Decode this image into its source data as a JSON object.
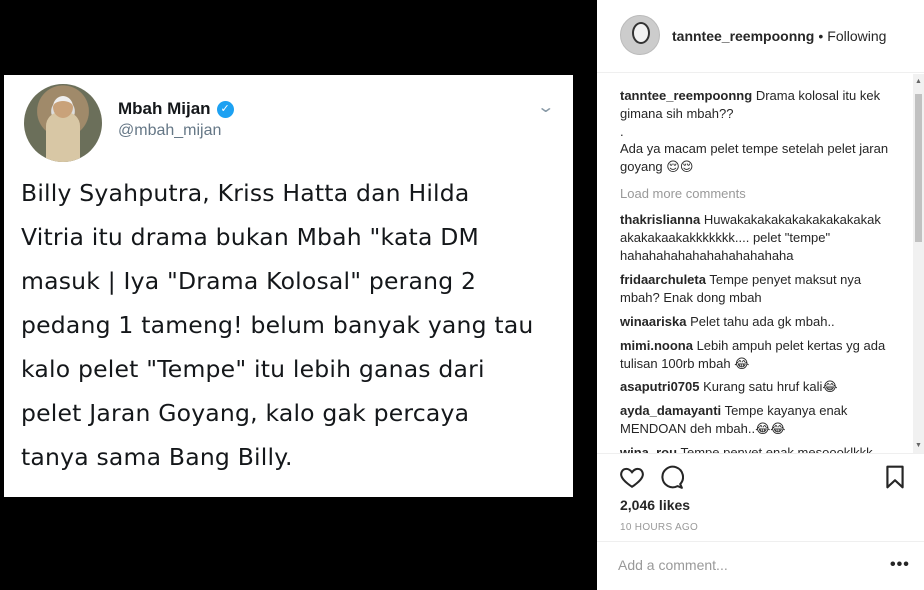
{
  "tweet": {
    "name": "Mbah Mijan",
    "handle": "@mbah_mijan",
    "text_lines": [
      "Billy Syahputra, Kriss Hatta dan Hilda",
      "Vitria itu drama bukan Mbah \"kata DM",
      "masuk | Iya \"Drama Kolosal\" perang 2",
      "pedang 1 tameng! belum banyak yang tau",
      "kalo pelet \"Tempe\" itu lebih ganas dari",
      "pelet Jaran Goyang, kalo gak percaya",
      "tanya sama Bang Billy."
    ],
    "verified_icon": "verified-badge-icon",
    "chevron_icon": "chevron-down-icon"
  },
  "header": {
    "username": "tanntee_reempoonng",
    "separator": "•",
    "follow_status": "Following"
  },
  "caption": {
    "username": "tanntee_reempoonng",
    "line1": "Drama kolosal itu kek gimana sih mbah??",
    "line2": ".",
    "line3": "Ada ya macam pelet tempe setelah pelet jaran goyang 😌😌"
  },
  "load_more": "Load more comments",
  "comments": [
    {
      "user": "thakrislianna",
      "text": "Huwakakakakakakakakakakak akakakaakakkkkkkk.... pelet \"tempe\" hahahahahahahahahahahaha"
    },
    {
      "user": "fridaarchuleta",
      "text": "Tempe penyet maksut nya mbah? Enak dong mbah"
    },
    {
      "user": "winaariska",
      "text": "Pelet tahu ada gk mbah.."
    },
    {
      "user": "mimi.noona",
      "text": "Lebih ampuh pelet kertas yg ada tulisan 100rb mbah 😂"
    },
    {
      "user": "asaputri0705",
      "text": "Kurang satu hruf kali😂"
    },
    {
      "user": "ayda_damayanti",
      "text": "Tempe kayanya enak MENDOAN deh mbah..😂😂"
    },
    {
      "user": "wina_rou",
      "text": "Tempe penyet enak mesoooklkkk"
    }
  ],
  "actions": {
    "like_icon": "heart-icon",
    "comment_icon": "comment-bubble-icon",
    "save_icon": "bookmark-icon"
  },
  "likes": "2,046 likes",
  "time_ago": "10 HOURS AGO",
  "add_comment": {
    "placeholder": "Add a comment...",
    "more_icon": "more-options-icon",
    "more_label": "•••"
  },
  "colors": {
    "background": "#000000",
    "panel": "#ffffff",
    "verified": "#1da1f2",
    "muted_text": "#999999"
  }
}
